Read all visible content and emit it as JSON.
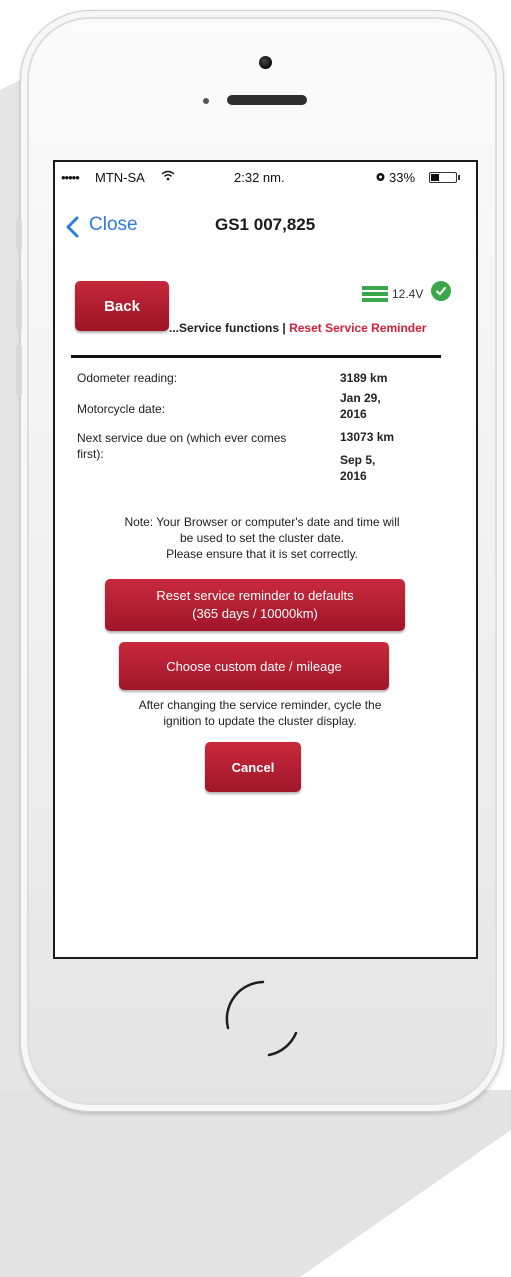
{
  "status_bar": {
    "signal": "•••••",
    "carrier": "MTN-SA",
    "wifi_icon": "wifi-icon",
    "time": "2:32 nm.",
    "alarm_icon": "alarm-icon",
    "battery_percent": "33%",
    "battery_level": 0.33
  },
  "nav": {
    "close_label": "Close",
    "title": "GS1 007,825"
  },
  "header": {
    "back_label": "Back",
    "voltage": "12.4V",
    "status_icon": "check-circle-icon",
    "breadcrumb_prefix": "...",
    "breadcrumb_section": "Service functions",
    "breadcrumb_separator": " | ",
    "breadcrumb_current": "Reset Service Reminder"
  },
  "info": {
    "odometer_label": "Odometer reading:",
    "odometer_value": "3189 km",
    "date_label": "Motorcycle date:",
    "date_value_line1": "Jan 29,",
    "date_value_line2": "2016",
    "next_label_line1": "Next service due on (which ever comes",
    "next_label_line2": "first):",
    "next_km_value": "13073 km",
    "next_date_line1": "Sep 5,",
    "next_date_line2": "2016"
  },
  "note": {
    "line1": "Note: Your Browser or computer's date and time will",
    "line2": "be used to set the cluster date.",
    "line3": "Please ensure that it is set correctly."
  },
  "buttons": {
    "reset_line1": "Reset service reminder to defaults",
    "reset_line2": "(365 days / 10000km)",
    "custom": "Choose custom date / mileage",
    "cancel": "Cancel"
  },
  "after_note": {
    "line1": "After changing the service reminder, cycle the",
    "line2": "ignition to update the cluster display."
  },
  "colors": {
    "accent_red": "#b01d30",
    "link_blue": "#2f7bd8",
    "ok_green": "#3aa84a"
  }
}
